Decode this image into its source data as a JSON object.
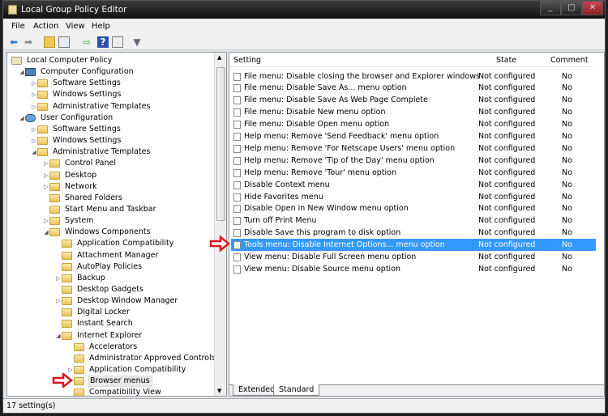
{
  "window": {
    "title": "Local Group Policy Editor"
  },
  "menu": [
    "File",
    "Action",
    "View",
    "Help"
  ],
  "toolbar": [
    "back-icon",
    "forward-icon",
    "up-folder-icon",
    "show-hide-tree-icon",
    "export-list-icon",
    "help-icon",
    "properties-icon",
    "filter-icon"
  ],
  "tree": [
    {
      "label": "Local Computer Policy",
      "level": 0,
      "arrow": "",
      "icon": "policy"
    },
    {
      "label": "Computer Configuration",
      "level": 1,
      "arrow": "expanded",
      "icon": "computer"
    },
    {
      "label": "Software Settings",
      "level": 2,
      "arrow": "collapsed",
      "icon": "folder"
    },
    {
      "label": "Windows Settings",
      "level": 2,
      "arrow": "collapsed",
      "icon": "folder"
    },
    {
      "label": "Administrative Templates",
      "level": 2,
      "arrow": "collapsed",
      "icon": "folder"
    },
    {
      "label": "User Configuration",
      "level": 1,
      "arrow": "expanded",
      "icon": "user"
    },
    {
      "label": "Software Settings",
      "level": 2,
      "arrow": "collapsed",
      "icon": "folder"
    },
    {
      "label": "Windows Settings",
      "level": 2,
      "arrow": "collapsed",
      "icon": "folder"
    },
    {
      "label": "Administrative Templates",
      "level": 2,
      "arrow": "expanded",
      "icon": "folder"
    },
    {
      "label": "Control Panel",
      "level": 3,
      "arrow": "collapsed",
      "icon": "folder"
    },
    {
      "label": "Desktop",
      "level": 3,
      "arrow": "collapsed",
      "icon": "folder"
    },
    {
      "label": "Network",
      "level": 3,
      "arrow": "collapsed",
      "icon": "folder"
    },
    {
      "label": "Shared Folders",
      "level": 3,
      "arrow": "",
      "icon": "folder"
    },
    {
      "label": "Start Menu and Taskbar",
      "level": 3,
      "arrow": "",
      "icon": "folder"
    },
    {
      "label": "System",
      "level": 3,
      "arrow": "collapsed",
      "icon": "folder"
    },
    {
      "label": "Windows Components",
      "level": 3,
      "arrow": "expanded",
      "icon": "folder"
    },
    {
      "label": "Application Compatibility",
      "level": 4,
      "arrow": "",
      "icon": "folder"
    },
    {
      "label": "Attachment Manager",
      "level": 4,
      "arrow": "",
      "icon": "folder"
    },
    {
      "label": "AutoPlay Policies",
      "level": 4,
      "arrow": "",
      "icon": "folder"
    },
    {
      "label": "Backup",
      "level": 4,
      "arrow": "collapsed",
      "icon": "folder"
    },
    {
      "label": "Desktop Gadgets",
      "level": 4,
      "arrow": "",
      "icon": "folder"
    },
    {
      "label": "Desktop Window Manager",
      "level": 4,
      "arrow": "collapsed",
      "icon": "folder"
    },
    {
      "label": "Digital Locker",
      "level": 4,
      "arrow": "",
      "icon": "folder"
    },
    {
      "label": "Instant Search",
      "level": 4,
      "arrow": "",
      "icon": "folder"
    },
    {
      "label": "Internet Explorer",
      "level": 4,
      "arrow": "expanded",
      "icon": "folder"
    },
    {
      "label": "Accelerators",
      "level": 5,
      "arrow": "",
      "icon": "folder"
    },
    {
      "label": "Administrator Approved Controls",
      "level": 5,
      "arrow": "",
      "icon": "folder"
    },
    {
      "label": "Application Compatibility",
      "level": 5,
      "arrow": "collapsed",
      "icon": "folder"
    },
    {
      "label": "Browser menus",
      "level": 5,
      "arrow": "",
      "icon": "folder",
      "selected": true,
      "marked": true
    },
    {
      "label": "Compatibility View",
      "level": 5,
      "arrow": "",
      "icon": "folder"
    }
  ],
  "list": {
    "columns": {
      "setting": "Setting",
      "state": "State",
      "comment": "Comment"
    },
    "rows": [
      {
        "setting": "File menu: Disable closing the browser and Explorer windows",
        "state": "Not configured",
        "comment": "No"
      },
      {
        "setting": "File menu: Disable Save As... menu option",
        "state": "Not configured",
        "comment": "No"
      },
      {
        "setting": "File menu: Disable Save As Web Page Complete",
        "state": "Not configured",
        "comment": "No"
      },
      {
        "setting": "File menu: Disable New menu option",
        "state": "Not configured",
        "comment": "No"
      },
      {
        "setting": "File menu: Disable Open menu option",
        "state": "Not configured",
        "comment": "No"
      },
      {
        "setting": "Help menu: Remove 'Send Feedback' menu option",
        "state": "Not configured",
        "comment": "No"
      },
      {
        "setting": "Help menu: Remove 'For Netscape Users' menu option",
        "state": "Not configured",
        "comment": "No"
      },
      {
        "setting": "Help menu: Remove 'Tip of the Day' menu option",
        "state": "Not configured",
        "comment": "No"
      },
      {
        "setting": "Help menu: Remove 'Tour' menu option",
        "state": "Not configured",
        "comment": "No"
      },
      {
        "setting": "Disable Context menu",
        "state": "Not configured",
        "comment": "No"
      },
      {
        "setting": "Hide Favorites menu",
        "state": "Not configured",
        "comment": "No"
      },
      {
        "setting": "Disable Open in New Window menu option",
        "state": "Not configured",
        "comment": "No"
      },
      {
        "setting": "Turn off Print Menu",
        "state": "Not configured",
        "comment": "No"
      },
      {
        "setting": "Disable Save this program to disk option",
        "state": "Not configured",
        "comment": "No"
      },
      {
        "setting": "Tools menu: Disable Internet Options... menu option",
        "state": "Not configured",
        "comment": "No",
        "selected": true,
        "marked": true
      },
      {
        "setting": "View menu: Disable Full Screen menu option",
        "state": "Not configured",
        "comment": "No"
      },
      {
        "setting": "View menu: Disable Source menu option",
        "state": "Not configured",
        "comment": "No"
      }
    ]
  },
  "tabs": [
    "Extended",
    "Standard"
  ],
  "active_tab": "Standard",
  "status": "17 setting(s)",
  "colors": {
    "selection": "#3399ff",
    "marker": "#e0141e"
  }
}
